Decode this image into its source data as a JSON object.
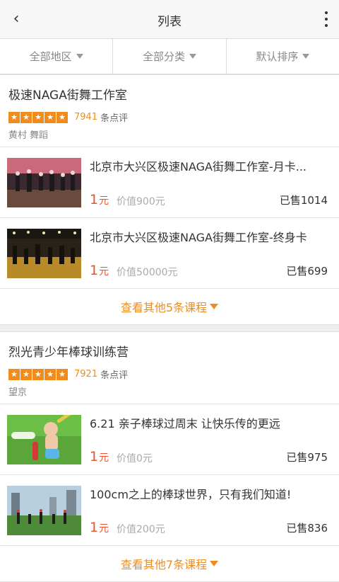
{
  "header": {
    "title": "列表",
    "back_icon": "back-arrow-icon",
    "menu_icon": "more-vertical-icon"
  },
  "filters": [
    {
      "label": "全部地区"
    },
    {
      "label": "全部分类"
    },
    {
      "label": "默认排序"
    }
  ],
  "shops": [
    {
      "name": "极速NAGA街舞工作室",
      "stars": 5,
      "review_count": "7941",
      "review_label": "条点评",
      "area": "黄村   舞蹈",
      "deals": [
        {
          "title": "北京市大兴区极速NAGA街舞工作室-月卡...",
          "price": "1",
          "price_unit": "元",
          "value": "价值900元",
          "sold": "已售1014"
        },
        {
          "title": "北京市大兴区极速NAGA街舞工作室-终身卡",
          "price": "1",
          "price_unit": "元",
          "value": "价值50000元",
          "sold": "已售699"
        }
      ],
      "more_label": "查看其他5条课程"
    },
    {
      "name": "烈光青少年棒球训练营",
      "stars": 5,
      "review_count": "7921",
      "review_label": "条点评",
      "area": "望京",
      "deals": [
        {
          "title": "6.21 亲子棒球过周末 让快乐传的更远",
          "price": "1",
          "price_unit": "元",
          "value": "价值0元",
          "sold": "已售975"
        },
        {
          "title": "100cm之上的棒球世界，只有我们知道!",
          "price": "1",
          "price_unit": "元",
          "value": "价值200元",
          "sold": "已售836"
        }
      ],
      "more_label": "查看其他7条课程"
    }
  ],
  "colors": {
    "accent": "#f08c1d",
    "price": "#e8542a"
  }
}
